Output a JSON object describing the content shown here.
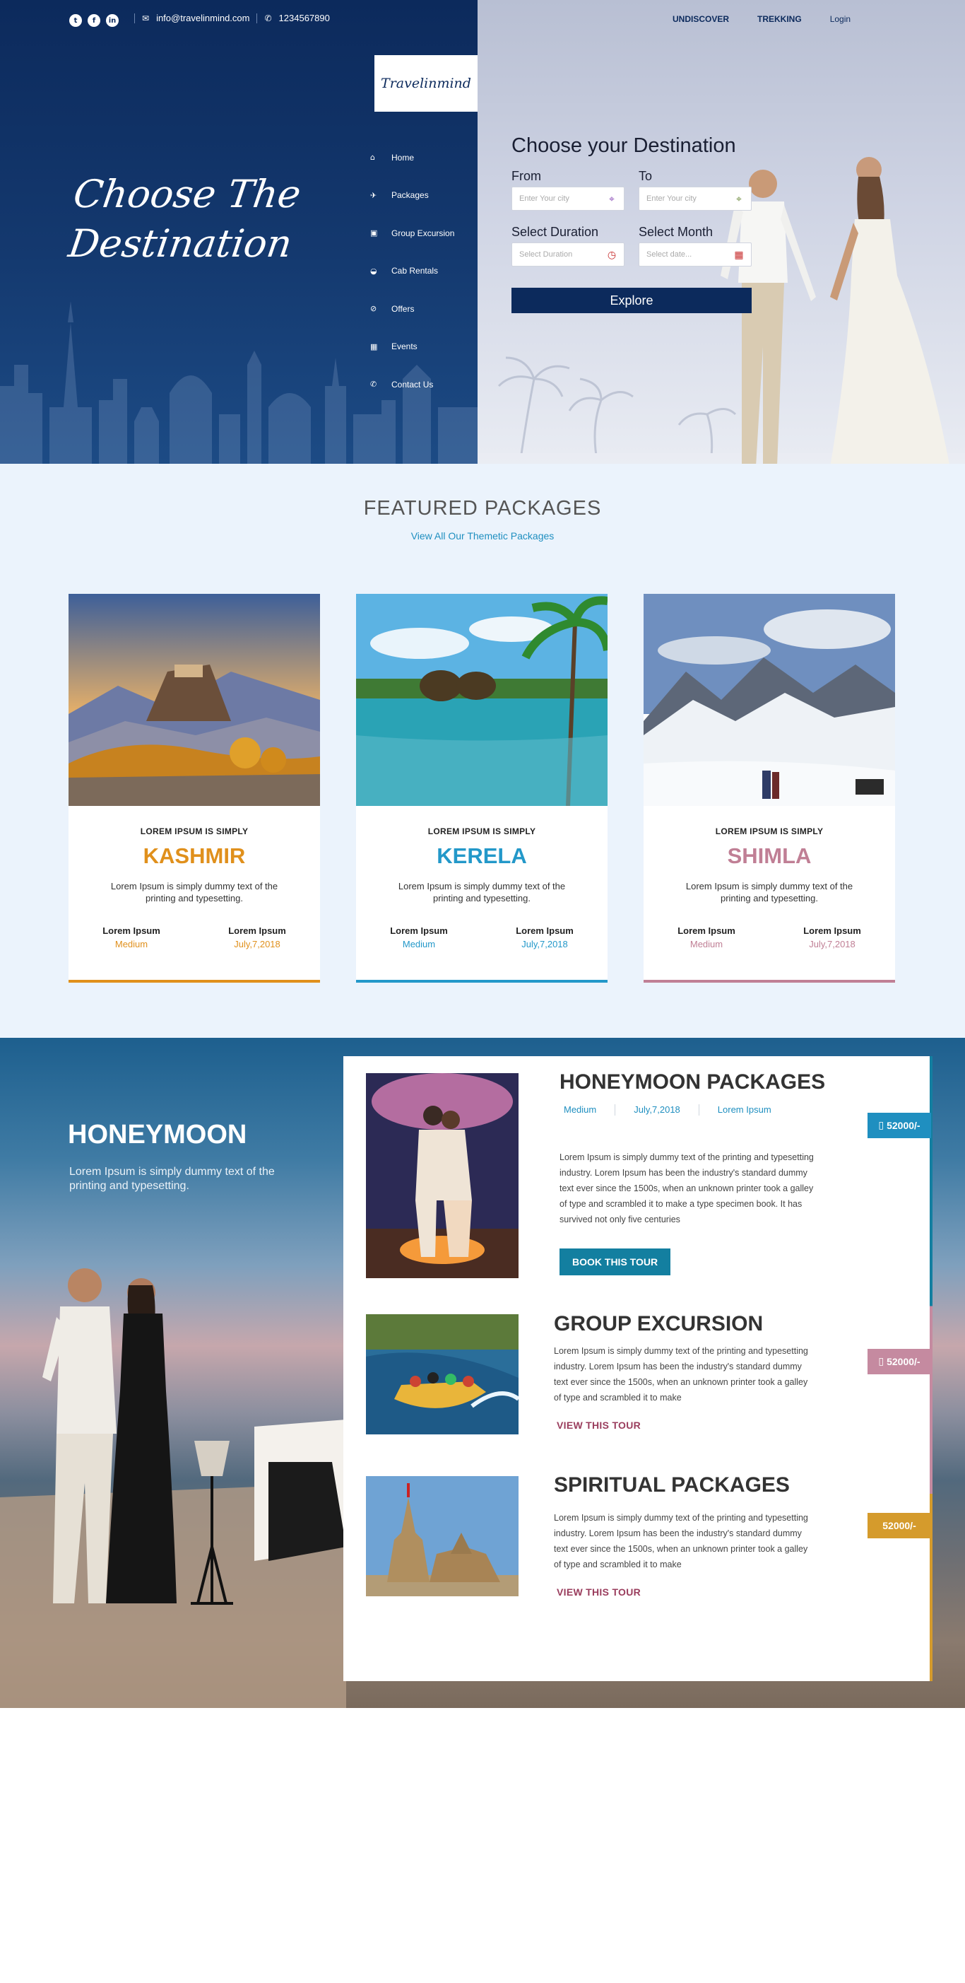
{
  "topbar": {
    "social_icons": [
      "twitter-icon",
      "facebook-icon",
      "linkedin-icon"
    ],
    "email": "info@travelinmind.com",
    "phone": "1234567890"
  },
  "topnav": {
    "items": [
      "UNDISCOVER",
      "TREKKING",
      "Login"
    ]
  },
  "logo": {
    "text": "Travelinmind"
  },
  "sidenav": {
    "items": [
      {
        "label": "Home",
        "icon": "home-icon"
      },
      {
        "label": "Packages",
        "icon": "plane-icon"
      },
      {
        "label": "Group Excursion",
        "icon": "bus-icon"
      },
      {
        "label": "Cab Rentals",
        "icon": "car-icon"
      },
      {
        "label": "Offers",
        "icon": "offer-icon"
      },
      {
        "label": "Events",
        "icon": "calendar-icon"
      },
      {
        "label": "Contact Us",
        "icon": "phone-icon"
      }
    ]
  },
  "hero": {
    "title_line1": "Choose The",
    "title_line2": "Destination"
  },
  "search": {
    "title": "Choose your Destination",
    "from_label": "From",
    "from_placeholder": "Enter Your city",
    "to_label": "To",
    "to_placeholder": "Enter Your city",
    "duration_label": "Select Duration",
    "duration_placeholder": "Select Duration",
    "month_label": "Select Month",
    "month_placeholder": "Select date...",
    "explore_label": "Explore"
  },
  "featured": {
    "title": "FEATURED PACKAGES",
    "link": "View All Our Themetic Packages",
    "cards": [
      {
        "subtitle": "LOREM IPSUM IS SIMPLY",
        "name": "KASHMIR",
        "desc": "Lorem Ipsum is simply dummy text of the printing and typesetting.",
        "meta1_label": "Lorem Ipsum",
        "meta1_value": "Medium",
        "meta2_label": "Lorem Ipsum",
        "meta2_value": "July,7,2018",
        "color": "#e0901c"
      },
      {
        "subtitle": "LOREM IPSUM IS SIMPLY",
        "name": "KERELA",
        "desc": "Lorem Ipsum is simply dummy text of the printing and typesetting.",
        "meta1_label": "Lorem Ipsum",
        "meta1_value": "Medium",
        "meta2_label": "Lorem Ipsum",
        "meta2_value": "July,7,2018",
        "color": "#2398c9"
      },
      {
        "subtitle": "LOREM IPSUM IS SIMPLY",
        "name": "SHIMLA",
        "desc": "Lorem Ipsum is simply dummy text of the printing and typesetting.",
        "meta1_label": "Lorem Ipsum",
        "meta1_value": "Medium",
        "meta2_label": "Lorem Ipsum",
        "meta2_value": "July,7,2018",
        "color": "#c07f95"
      }
    ]
  },
  "honeymoon": {
    "title": "HONEYMOON",
    "subtitle": "Lorem Ipsum is simply dummy text of the printing and typesetting.",
    "packages": [
      {
        "title": "HONEYMOON PACKAGES",
        "meta": [
          "Medium",
          "July,7,2018",
          "Lorem Ipsum"
        ],
        "desc": "Lorem Ipsum is simply dummy text of the printing and typesetting industry. Lorem Ipsum has been the industry's standard dummy text ever since the 1500s, when an unknown printer took a galley of type and scrambled it to make a type specimen book. It has survived not only five centuries",
        "button": "BOOK THIS TOUR",
        "price": "52000/-",
        "price_color": "#1f8fc0"
      },
      {
        "title": "GROUP EXCURSION",
        "desc": "Lorem Ipsum is simply dummy text of the printing and typesetting industry. Lorem Ipsum has been the industry's standard dummy text ever since the 1500s, when an unknown printer took a galley of type and scrambled it to make",
        "link": "VIEW THIS TOUR",
        "price": "52000/-",
        "price_color": "#c58aa0"
      },
      {
        "title": "SPIRITUAL PACKAGES",
        "desc": "Lorem Ipsum is simply dummy text of the printing and typesetting industry. Lorem Ipsum has been the industry's standard dummy text ever since the 1500s, when an unknown printer took a galley of type and scrambled it to make",
        "link": "VIEW THIS TOUR",
        "price": "52000/-",
        "price_color": "#d59b2c"
      }
    ]
  }
}
